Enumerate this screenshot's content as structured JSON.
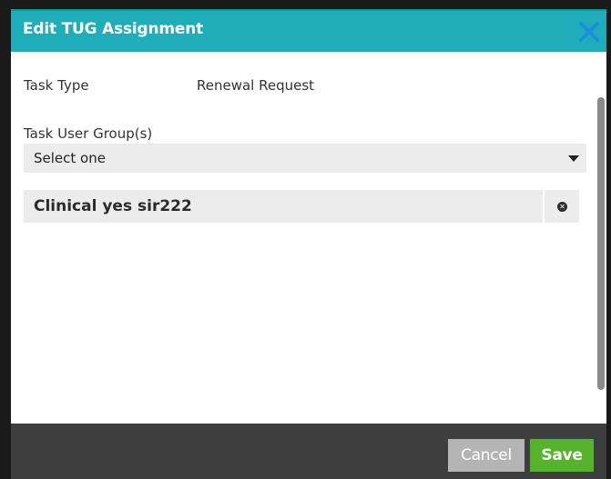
{
  "dialog": {
    "title": "Edit TUG Assignment",
    "close_icon": "close-icon",
    "accent_color": "#1fadba"
  },
  "form": {
    "task_type_label": "Task Type",
    "task_type_value": "Renewal Request",
    "task_user_groups_label": "Task User Group(s)",
    "select_value": "Select one",
    "selected_groups": [
      {
        "label": "Clinical yes sir222"
      }
    ]
  },
  "footer": {
    "cancel_label": "Cancel",
    "save_label": "Save",
    "save_color": "#55b32c",
    "cancel_color": "#b4b4b4"
  }
}
